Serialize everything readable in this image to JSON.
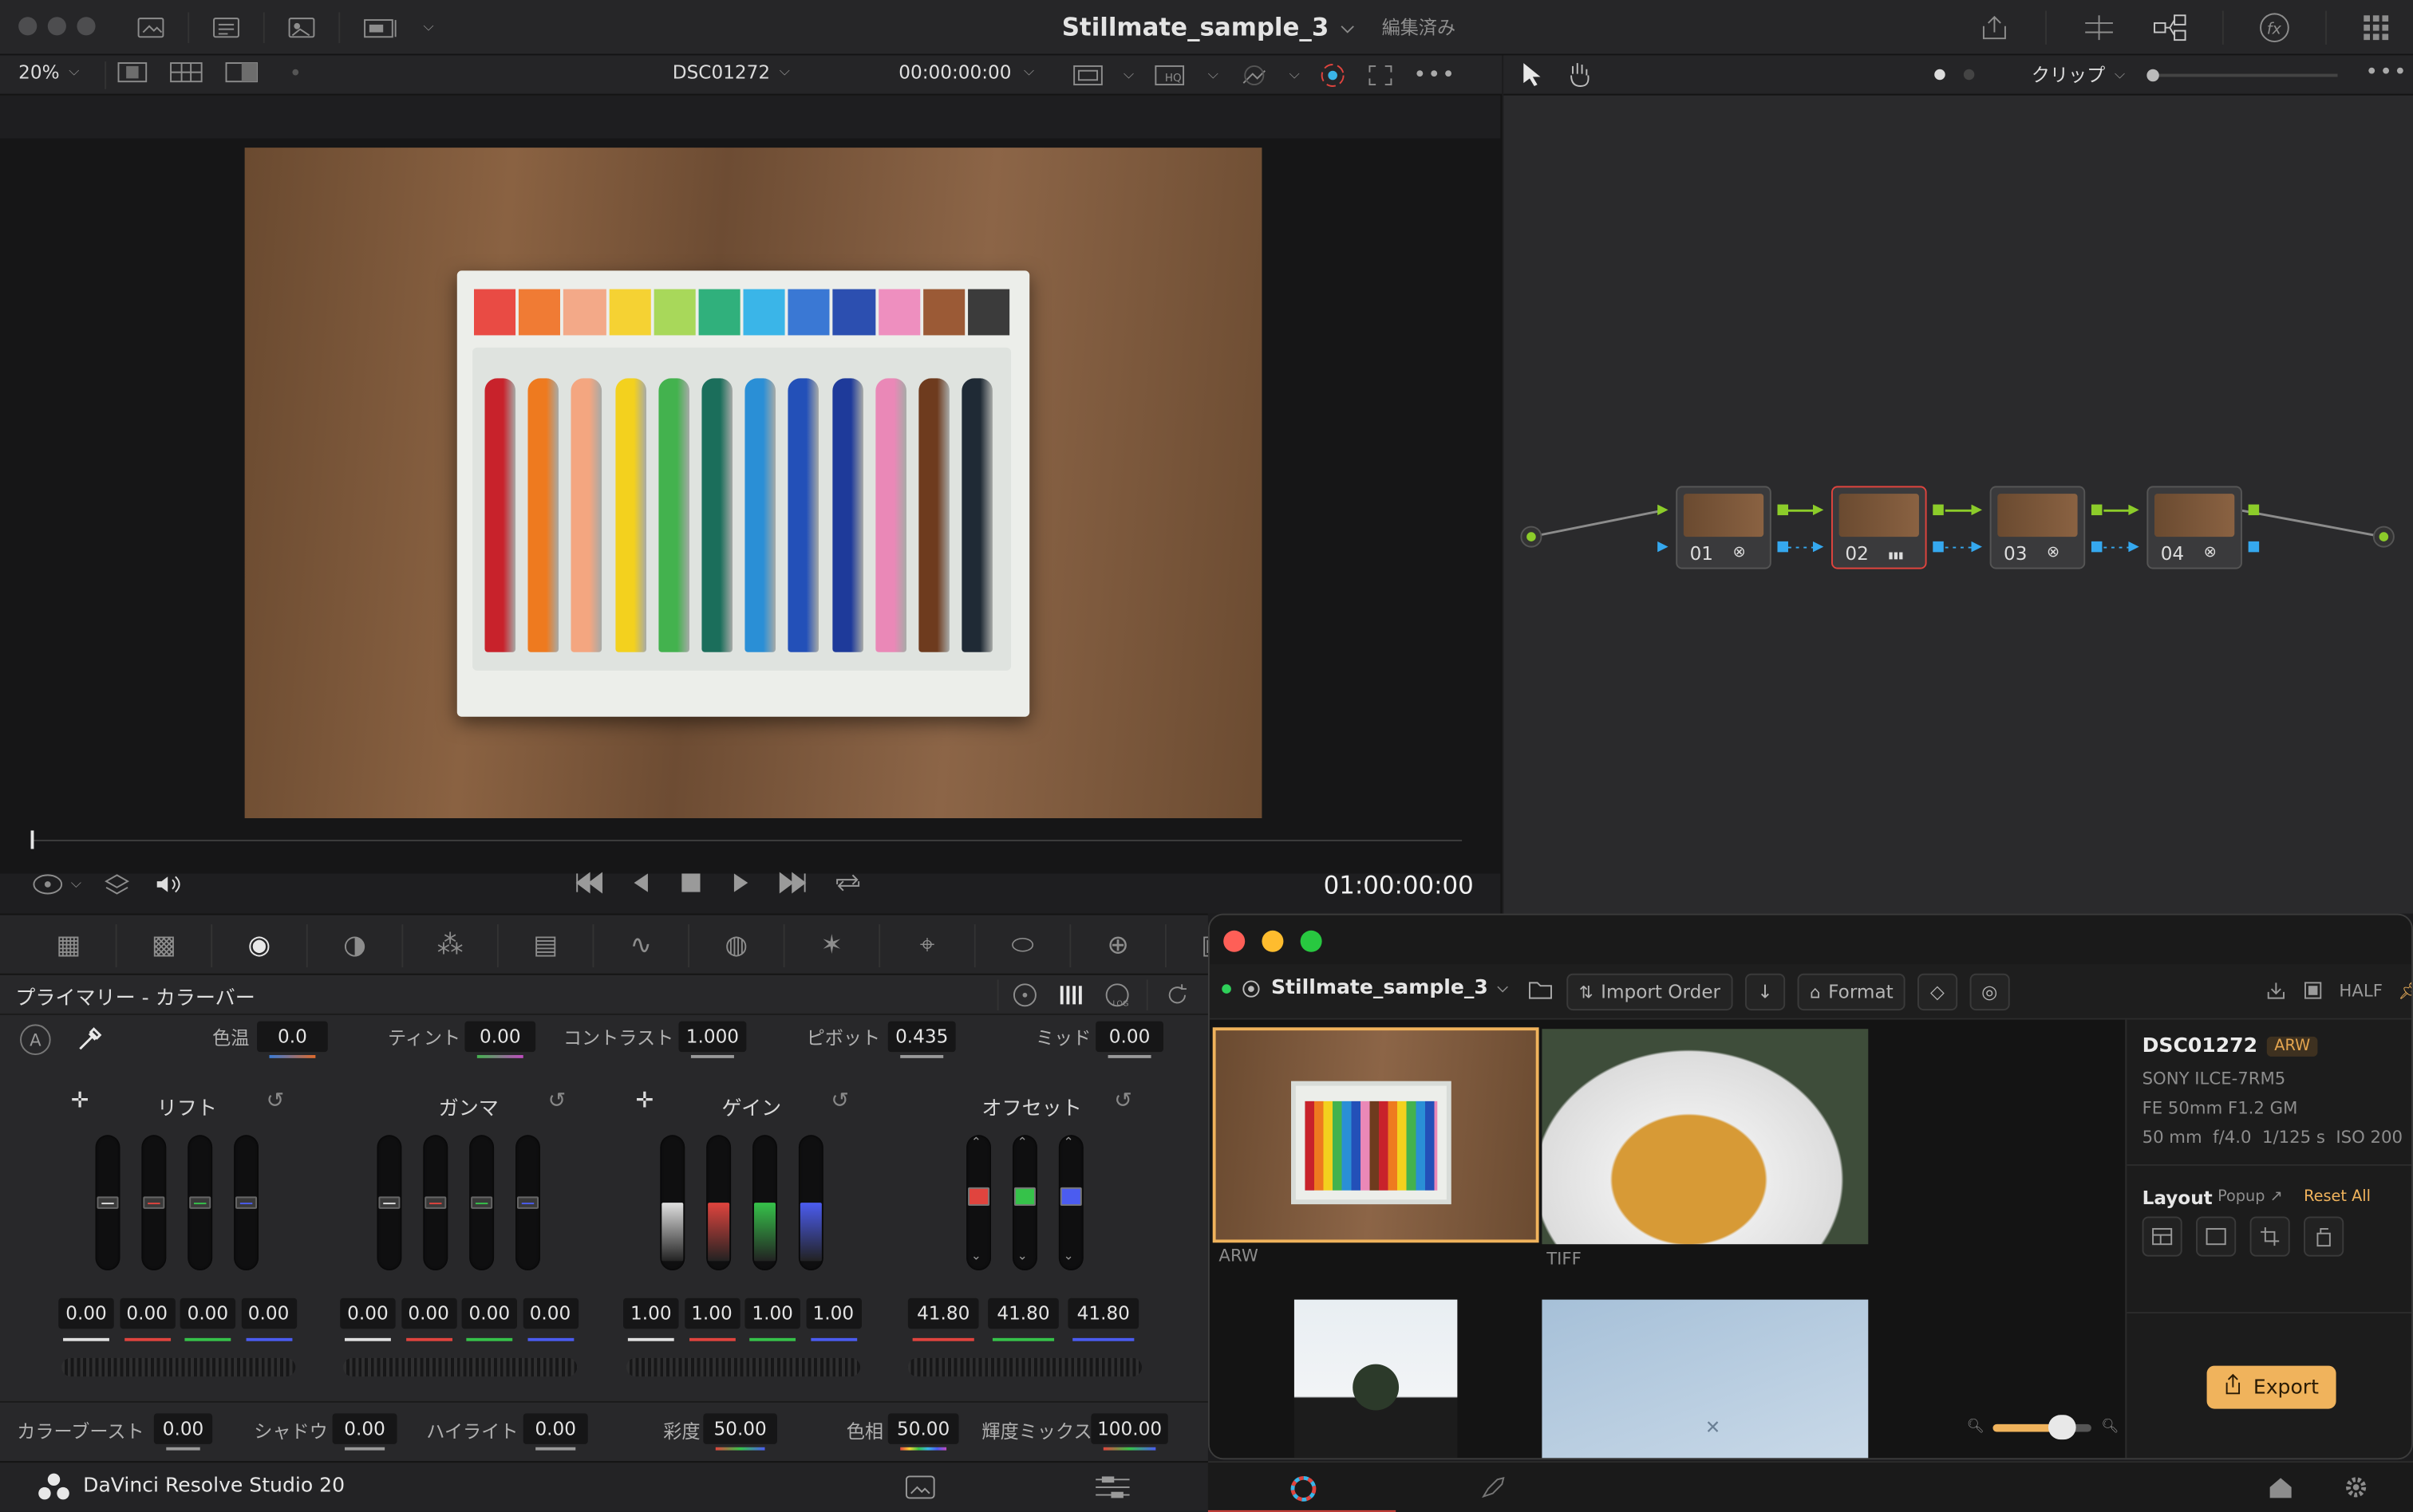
{
  "topbar": {
    "project_title": "Stillmate_sample_3",
    "status": "編集済み"
  },
  "viewer": {
    "zoom": "20%",
    "clip_name": "DSC01272",
    "timecode_top": "00:00:00:00",
    "timecode": "01:00:00:00",
    "scrub_progress": 0.0
  },
  "node_editor": {
    "mode": "クリップ",
    "nodes": [
      {
        "label": "01",
        "badge_icon": "fx-icon",
        "selected": false
      },
      {
        "label": "02",
        "badge_icon": "bars-icon",
        "selected": true
      },
      {
        "label": "03",
        "badge_icon": "fx-icon",
        "selected": false
      },
      {
        "label": "04",
        "badge_icon": "fx-icon",
        "selected": false
      }
    ]
  },
  "primary": {
    "panel_title": "プライマリー - カラーバー",
    "top_params": [
      {
        "label": "色温",
        "value": "0.0"
      },
      {
        "label": "ティント",
        "value": "0.00"
      },
      {
        "label": "コントラスト",
        "value": "1.000"
      },
      {
        "label": "ピボット",
        "value": "0.435"
      },
      {
        "label": "ミッド",
        "value": "0.00"
      }
    ],
    "groups": [
      {
        "name": "リフト",
        "values": [
          "0.00",
          "0.00",
          "0.00",
          "0.00"
        ]
      },
      {
        "name": "ガンマ",
        "values": [
          "0.00",
          "0.00",
          "0.00",
          "0.00"
        ]
      },
      {
        "name": "ゲイン",
        "values": [
          "1.00",
          "1.00",
          "1.00",
          "1.00"
        ]
      },
      {
        "name": "オフセット",
        "values": [
          "41.80",
          "41.80",
          "41.80"
        ]
      }
    ],
    "bottom_params": [
      {
        "label": "カラーブースト",
        "value": "0.00"
      },
      {
        "label": "シャドウ",
        "value": "0.00"
      },
      {
        "label": "ハイライト",
        "value": "0.00"
      },
      {
        "label": "彩度",
        "value": "50.00"
      },
      {
        "label": "色相",
        "value": "50.00"
      },
      {
        "label": "輝度ミックス",
        "value": "100.00"
      }
    ]
  },
  "app": {
    "name": "DaVinci Resolve Studio 20"
  },
  "stillmate": {
    "project": "Stillmate_sample_3",
    "sort_label": "Import Order",
    "format_label": "Format",
    "quality": "HALF",
    "thumbnails": [
      {
        "format": "ARW",
        "selected": true
      },
      {
        "format": "TIFF",
        "selected": false
      },
      {
        "format": "",
        "selected": false
      },
      {
        "format": "",
        "selected": false
      }
    ],
    "thumb_size_level": 0.7,
    "info": {
      "file": "DSC01272",
      "badge": "ARW",
      "camera": "SONY ILCE-7RM5",
      "lens": "FE 50mm F1.2 GM",
      "exposure": "50 mm  f/4.0  1/125 s  ISO 200"
    },
    "layout": {
      "title": "Layout",
      "popup_label": "Popup ↗",
      "reset_label": "Reset All"
    },
    "export_label": "Export"
  },
  "colors": {
    "accent_red": "#e0443e",
    "export_bg": "#f0b35c",
    "node_input": "#8ccc2a",
    "node_link": "#35a8ef"
  }
}
